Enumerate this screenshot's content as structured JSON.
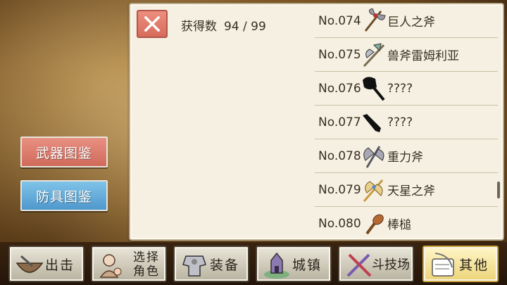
{
  "left_menu": {
    "weapon_catalog": "武器图鉴",
    "armor_catalog": "防具图鉴"
  },
  "panel": {
    "count_label": "获得数",
    "count_value": "94 / 99",
    "rows": [
      {
        "num": "No.074",
        "name": "巨人之斧",
        "icon": "double-axe-icon"
      },
      {
        "num": "No.075",
        "name": "兽斧雷姆利亚",
        "icon": "beast-axe-icon"
      },
      {
        "num": "No.076",
        "name": "????",
        "icon": "unknown-silhouette-icon"
      },
      {
        "num": "No.077",
        "name": "????",
        "icon": "unknown-silhouette-icon"
      },
      {
        "num": "No.078",
        "name": "重力斧",
        "icon": "gravity-axe-icon"
      },
      {
        "num": "No.079",
        "name": "天星之斧",
        "icon": "star-axe-icon"
      },
      {
        "num": "No.080",
        "name": "棒槌",
        "icon": "club-icon"
      }
    ]
  },
  "nav": {
    "sortie": "出击",
    "select_char_1": "选择",
    "select_char_2": "角色",
    "equip": "装备",
    "town": "城镇",
    "arena": "斗技场",
    "other": "其他"
  }
}
